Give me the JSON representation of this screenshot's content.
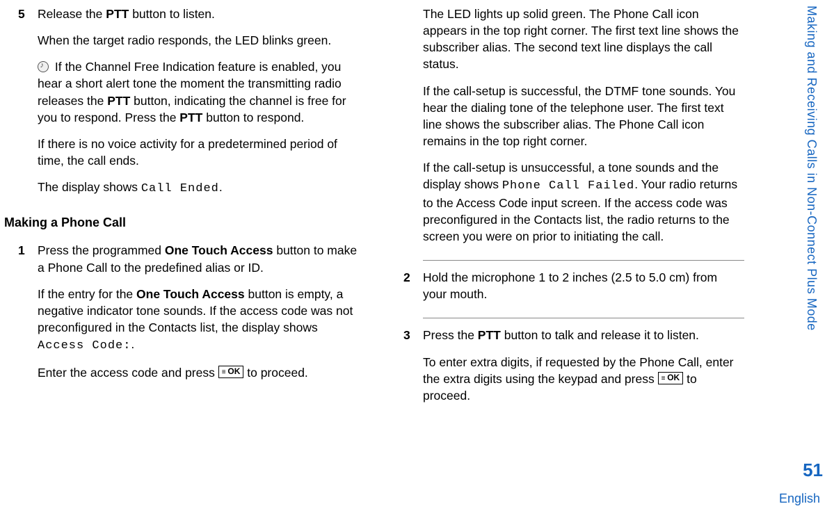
{
  "sideHeader": "Making and Receiving Calls in Non-Connect Plus Mode",
  "pageNumber": "51",
  "language": "English",
  "okLabel": "OK",
  "col1": {
    "step5": {
      "num": "5",
      "p1a": "Release the ",
      "p1b": "PTT",
      "p1c": " button to listen.",
      "p2": "When the target radio responds, the LED blinks green.",
      "p3a": " If the Channel Free Indication feature is enabled, you hear a short alert tone the moment the transmitting radio releases the ",
      "p3b": "PTT",
      "p3c": " button, indicating the channel is free for you to respond. Press the ",
      "p3d": "PTT",
      "p3e": " button to respond.",
      "p4": "If there is no voice activity for a predetermined period of time, the call ends.",
      "p5a": "The display shows ",
      "p5b": "Call Ended",
      "p5c": "."
    },
    "heading": "Making a Phone Call",
    "step1": {
      "num": "1",
      "p1a": "Press the programmed ",
      "p1b": "One Touch Access",
      "p1c": " button to make a Phone Call to the predefined alias or ID.",
      "p2a": "If the entry for the ",
      "p2b": "One Touch Access",
      "p2c": " button is empty, a negative indicator tone sounds. If the access code was not preconfigured in the Contacts list, the display shows ",
      "p2d": "Access Code:",
      "p2e": ".",
      "p3a": "Enter the access code and press ",
      "p3b": " to proceed."
    }
  },
  "col2": {
    "topBlock": {
      "p1": "The LED lights up solid green. The Phone Call icon appears in the top right corner. The first text line shows the subscriber alias. The second text line displays the call status.",
      "p2": "If the call-setup is successful, the DTMF tone sounds. You hear the dialing tone of the telephone user. The first text line shows the subscriber alias. The Phone Call icon remains in the top right corner.",
      "p3a": "If the call-setup is unsuccessful, a tone sounds and the display shows ",
      "p3b": "Phone Call Failed",
      "p3c": ". Your radio returns to the Access Code input screen. If the access code was preconfigured in the Contacts list, the radio returns to the screen you were on prior to initiating the call."
    },
    "step2": {
      "num": "2",
      "p1": "Hold the microphone 1 to 2 inches (2.5 to 5.0 cm) from your mouth."
    },
    "step3": {
      "num": "3",
      "p1a": "Press the ",
      "p1b": "PTT",
      "p1c": " button to talk and release it to listen.",
      "p2a": "To enter extra digits, if requested by the Phone Call, enter the extra digits using the keypad and press ",
      "p2b": " to proceed."
    }
  }
}
